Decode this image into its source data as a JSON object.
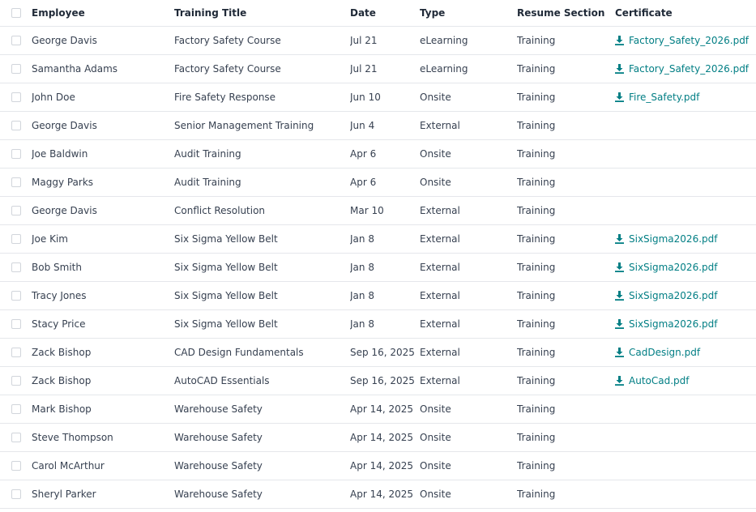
{
  "colors": {
    "link": "#017e84",
    "border": "#e5e7eb",
    "text": "#374151"
  },
  "columns": {
    "employee": "Employee",
    "training_title": "Training Title",
    "date": "Date",
    "type": "Type",
    "resume_section": "Resume Section",
    "certificate": "Certificate"
  },
  "rows": [
    {
      "employee": "George Davis",
      "title": "Factory Safety Course",
      "date": "Jul 21",
      "type": "eLearning",
      "section": "Training",
      "certificate": "Factory_Safety_2026.pdf"
    },
    {
      "employee": "Samantha Adams",
      "title": "Factory Safety Course",
      "date": "Jul 21",
      "type": "eLearning",
      "section": "Training",
      "certificate": "Factory_Safety_2026.pdf"
    },
    {
      "employee": "John Doe",
      "title": "Fire Safety Response",
      "date": "Jun 10",
      "type": "Onsite",
      "section": "Training",
      "certificate": "Fire_Safety.pdf"
    },
    {
      "employee": "George Davis",
      "title": "Senior Management Training",
      "date": "Jun 4",
      "type": "External",
      "section": "Training",
      "certificate": ""
    },
    {
      "employee": "Joe Baldwin",
      "title": "Audit Training",
      "date": "Apr 6",
      "type": "Onsite",
      "section": "Training",
      "certificate": ""
    },
    {
      "employee": "Maggy Parks",
      "title": "Audit Training",
      "date": "Apr 6",
      "type": "Onsite",
      "section": "Training",
      "certificate": ""
    },
    {
      "employee": "George Davis",
      "title": "Conflict Resolution",
      "date": "Mar 10",
      "type": "External",
      "section": "Training",
      "certificate": ""
    },
    {
      "employee": "Joe Kim",
      "title": "Six Sigma Yellow Belt",
      "date": "Jan 8",
      "type": "External",
      "section": "Training",
      "certificate": "SixSigma2026.pdf"
    },
    {
      "employee": "Bob Smith",
      "title": "Six Sigma Yellow Belt",
      "date": "Jan 8",
      "type": "External",
      "section": "Training",
      "certificate": "SixSigma2026.pdf"
    },
    {
      "employee": "Tracy Jones",
      "title": "Six Sigma Yellow Belt",
      "date": "Jan 8",
      "type": "External",
      "section": "Training",
      "certificate": "SixSigma2026.pdf"
    },
    {
      "employee": "Stacy Price",
      "title": "Six Sigma Yellow Belt",
      "date": "Jan 8",
      "type": "External",
      "section": "Training",
      "certificate": "SixSigma2026.pdf"
    },
    {
      "employee": "Zack Bishop",
      "title": "CAD Design Fundamentals",
      "date": "Sep 16, 2025",
      "type": "External",
      "section": "Training",
      "certificate": "CadDesign.pdf"
    },
    {
      "employee": "Zack Bishop",
      "title": "AutoCAD Essentials",
      "date": "Sep 16, 2025",
      "type": "External",
      "section": "Training",
      "certificate": "AutoCad.pdf"
    },
    {
      "employee": "Mark Bishop",
      "title": "Warehouse Safety",
      "date": "Apr 14, 2025",
      "type": "Onsite",
      "section": "Training",
      "certificate": ""
    },
    {
      "employee": "Steve Thompson",
      "title": "Warehouse Safety",
      "date": "Apr 14, 2025",
      "type": "Onsite",
      "section": "Training",
      "certificate": ""
    },
    {
      "employee": "Carol McArthur",
      "title": "Warehouse Safety",
      "date": "Apr 14, 2025",
      "type": "Onsite",
      "section": "Training",
      "certificate": ""
    },
    {
      "employee": "Sheryl Parker",
      "title": "Warehouse Safety",
      "date": "Apr 14, 2025",
      "type": "Onsite",
      "section": "Training",
      "certificate": ""
    }
  ]
}
